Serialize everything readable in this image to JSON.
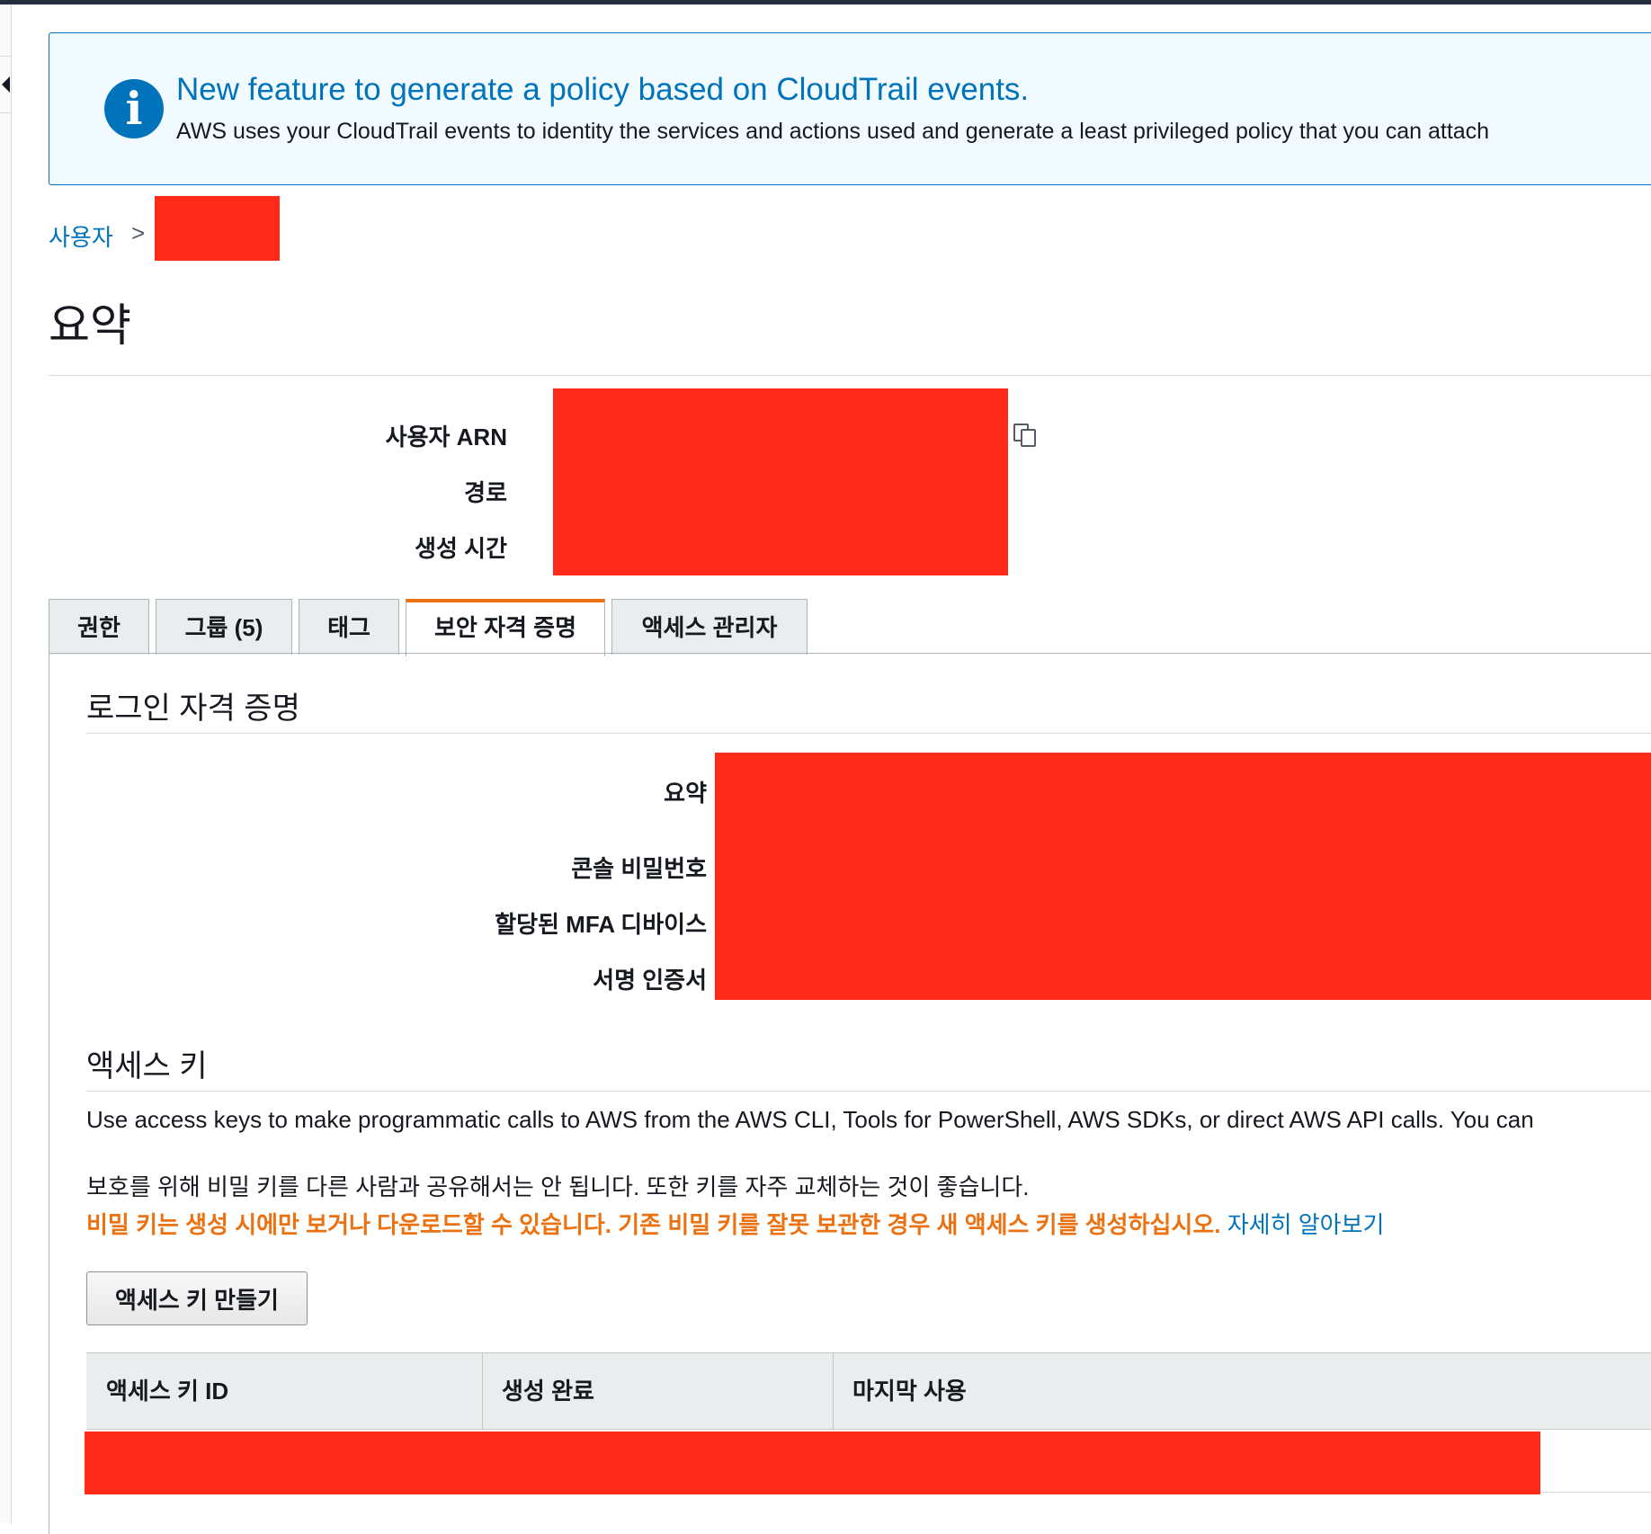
{
  "banner": {
    "title": "New feature to generate a policy based on CloudTrail events.",
    "text": "AWS uses your CloudTrail events to identity the services and actions used and generate a least privileged policy that you can attach"
  },
  "breadcrumb": {
    "users_label": "사용자",
    "separator": ">"
  },
  "page": {
    "title": "요약"
  },
  "summary": {
    "arn_label": "사용자 ARN",
    "path_label": "경로",
    "created_label": "생성 시간"
  },
  "tabs": [
    {
      "label": "권한"
    },
    {
      "label": "그룹 (5)"
    },
    {
      "label": "태그"
    },
    {
      "label": "보안 자격 증명",
      "active": true
    },
    {
      "label": "액세스 관리자"
    }
  ],
  "signin": {
    "title": "로그인 자격 증명",
    "summary_label": "요약",
    "console_password_label": "콘솔 비밀번호",
    "mfa_label": "할당된 MFA 디바이스",
    "signing_cert_label": "서명 인증서"
  },
  "access_keys": {
    "title": "액세스 키",
    "description": "Use access keys to make programmatic calls to AWS from the AWS CLI, Tools for PowerShell, AWS SDKs, or direct AWS API calls. You can",
    "protect_note": "보호를 위해 비밀 키를 다른 사람과 공유해서는 안 됩니다. 또한 키를 자주 교체하는 것이 좋습니다.",
    "warning": "비밀 키는 생성 시에만 보거나 다운로드할 수 있습니다. 기존 비밀 키를 잘못 보관한 경우 새 액세스 키를 생성하십시오.",
    "learn_more": "자세히 알아보기",
    "create_button": "액세스 키 만들기",
    "columns": [
      "액세스 키 ID",
      "생성 완료",
      "마지막 사용"
    ]
  },
  "colors": {
    "link_blue": "#0073bb",
    "warning_orange": "#ec7211",
    "active_tab_accent": "#ec7211",
    "redaction_red": "#ff2a1a",
    "info_bg": "#f1faff"
  },
  "icons": [
    "info-icon",
    "chevron-right-icon",
    "copy-icon",
    "collapse-arrow-icon"
  ]
}
